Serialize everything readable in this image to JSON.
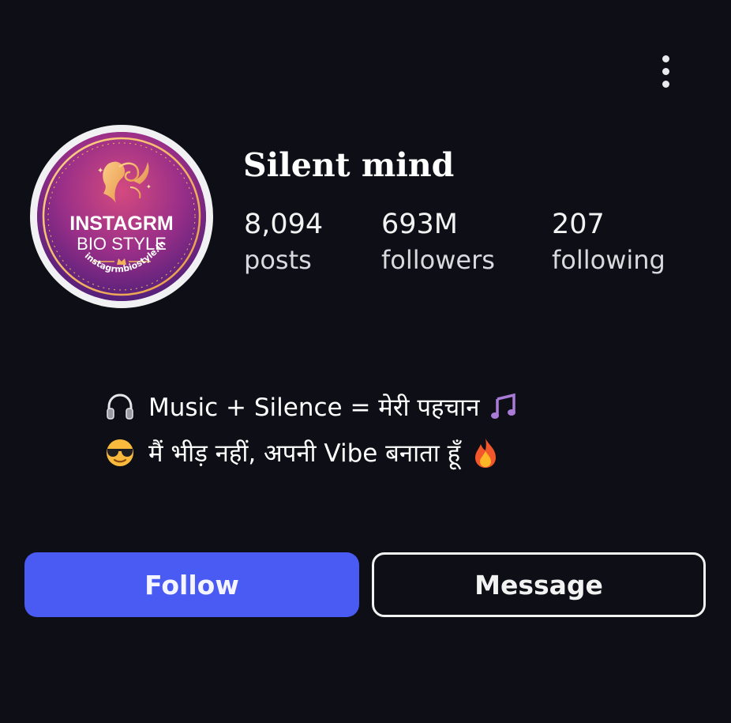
{
  "header": {
    "more_icon": "more-vertical-icon"
  },
  "profile": {
    "username": "Silent mind",
    "avatar": {
      "logo_line1": "INSTAGRM",
      "logo_line2": "BIO STYLE",
      "logo_url": "instagrmbiostyle.in",
      "colors": {
        "ring": "#f1f1f3",
        "gradient_center": "#c23f86",
        "gradient_edge": "#5a1f78",
        "gold": "#f2b35a"
      }
    },
    "stats": [
      {
        "value": "8,094",
        "label": "posts"
      },
      {
        "value": "693M",
        "label": "followers"
      },
      {
        "value": "207",
        "label": "following"
      }
    ]
  },
  "bio": {
    "lines": [
      {
        "icon": "headphones-icon",
        "text": "Music + Silence = मेरी पहचान",
        "trailing_icon": "music-notes-icon"
      },
      {
        "icon": "sunglasses-face-icon",
        "text": "मैं भीड़ नहीं, अपनी Vibe बनाता हूँ",
        "trailing_icon": "fire-icon"
      }
    ]
  },
  "actions": {
    "follow_label": "Follow",
    "message_label": "Message"
  },
  "colors": {
    "background": "#0e0f16",
    "follow_button": "#4a5bf3",
    "text": "#ffffff"
  }
}
